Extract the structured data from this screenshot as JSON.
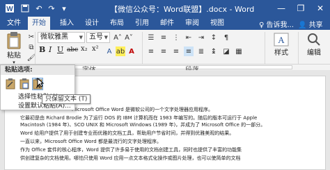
{
  "titlebar": {
    "title": "【微信公众号：Word联盟】.docx - Word",
    "minimize": "—",
    "restore": "❐",
    "close": "✕"
  },
  "tabs": [
    {
      "label": "文件"
    },
    {
      "label": "开始"
    },
    {
      "label": "插入"
    },
    {
      "label": "设计"
    },
    {
      "label": "布局"
    },
    {
      "label": "引用"
    },
    {
      "label": "邮件"
    },
    {
      "label": "审阅"
    },
    {
      "label": "视图"
    }
  ],
  "tell_me": "♀ 告诉我...",
  "share": "共享",
  "ribbon": {
    "paste_label": "粘贴",
    "font_name": "微软雅黑",
    "font_size": "五号",
    "style_label": "样式",
    "editing_label": "编辑",
    "format_buttons": [
      "B",
      "I",
      "U",
      "abc",
      "x₂",
      "x²"
    ],
    "font_group_label": "字体",
    "para_group_label": "段落"
  },
  "paste_menu": {
    "header": "粘贴选项:",
    "item1": "选择性粘贴(S)...",
    "item2": "设置默认粘贴(A)..."
  },
  "tooltip": "只保留文本 (T)",
  "document": {
    "paragraphs": [
      "Microsoft Office Word 是微软公司的一个文字处理器应用程序。",
      "它最初是由 Richard Brodie 为了运行 DOS 的 IBM 计算机而在 1983 年编写的。随后的版本可运行于 Apple",
      "Macintosh (1984 年)、SCO UNIX 和 Microsoft Windows (1989 年)，并成为了 Microsoft Office 的一部分。",
      "Word 给用户提供了用于创建专业而优雅的文档工具，帮助用户节省时间，并得到优雅美观的结果。",
      "一直以来，Microsoft Office Word 都是最流行的文字处理程序。",
      "作为 Office 套件的核心程序，Word 提供了许多易于使用的文档创建工具，同时也提供了丰富的功能集",
      "供创建复杂的文档使用。哪怕只使用 Word 应用一点文本格式化操作或图片处理，也可以使简单的文档"
    ]
  }
}
